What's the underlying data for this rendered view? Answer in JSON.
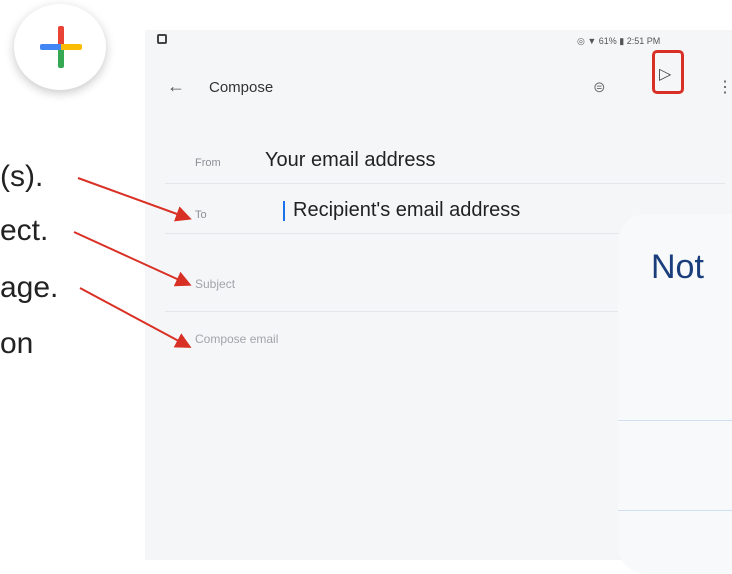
{
  "fab": {
    "icon": "plus-icon",
    "colors": [
      "#ea4335",
      "#fbbc04",
      "#34a853",
      "#4285f4"
    ]
  },
  "slide_fragments": [
    "(s).",
    "ect.",
    "age.",
    "on"
  ],
  "status_bar": {
    "text": "◎ ▼ 61% ▮ 2:51 PM"
  },
  "app_bar": {
    "back": "←",
    "title": "Compose",
    "attach": "⊜",
    "send": "▷",
    "more": "⋮"
  },
  "form": {
    "from_label": "From",
    "from_value": "Your email address",
    "to_label": "To",
    "to_value": "Recipient's email address",
    "subject_placeholder": "Subject",
    "body_placeholder": "Compose email"
  },
  "overlay": {
    "title": "Not"
  },
  "colors": {
    "accent_red": "#d93025",
    "cursor_blue": "#1a73e8",
    "overlay_title": "#1a3d7c"
  }
}
